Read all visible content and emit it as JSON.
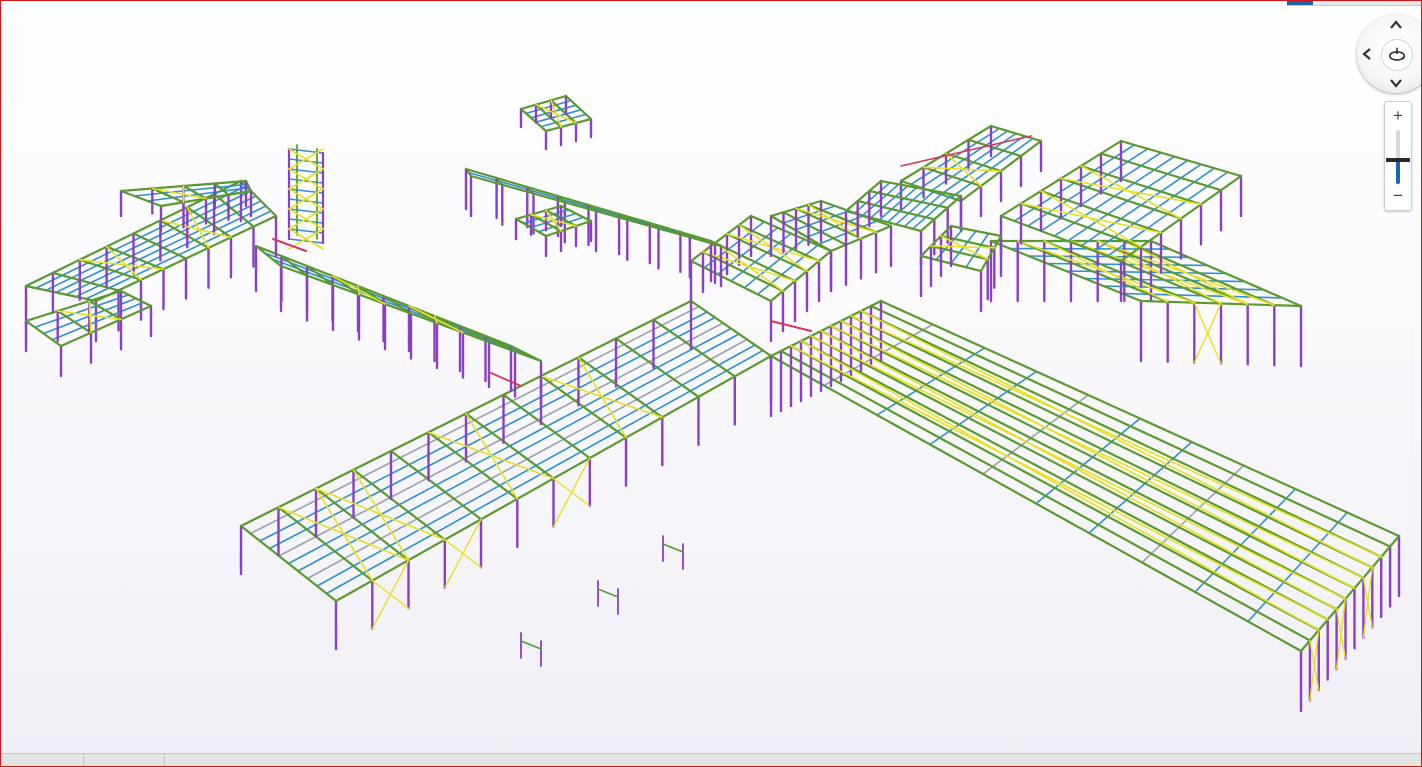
{
  "viewer": {
    "frame_color": "#d01818",
    "structure_colors": {
      "column": "#8b3fc4",
      "beam": "#5a9a2f",
      "purlin": "#2f8fd2",
      "bracing": "#e8e020",
      "member_red": "#d23a5c",
      "grey_member": "#9aa0ae"
    }
  },
  "navigation": {
    "wheel_icons": [
      "chevron-up-icon",
      "chevron-left-icon",
      "chevron-down-icon",
      "chevron-right-icon",
      "orbit-icon"
    ]
  },
  "zoom": {
    "in_label": "+",
    "out_label": "−",
    "level_fraction": 0.45
  }
}
